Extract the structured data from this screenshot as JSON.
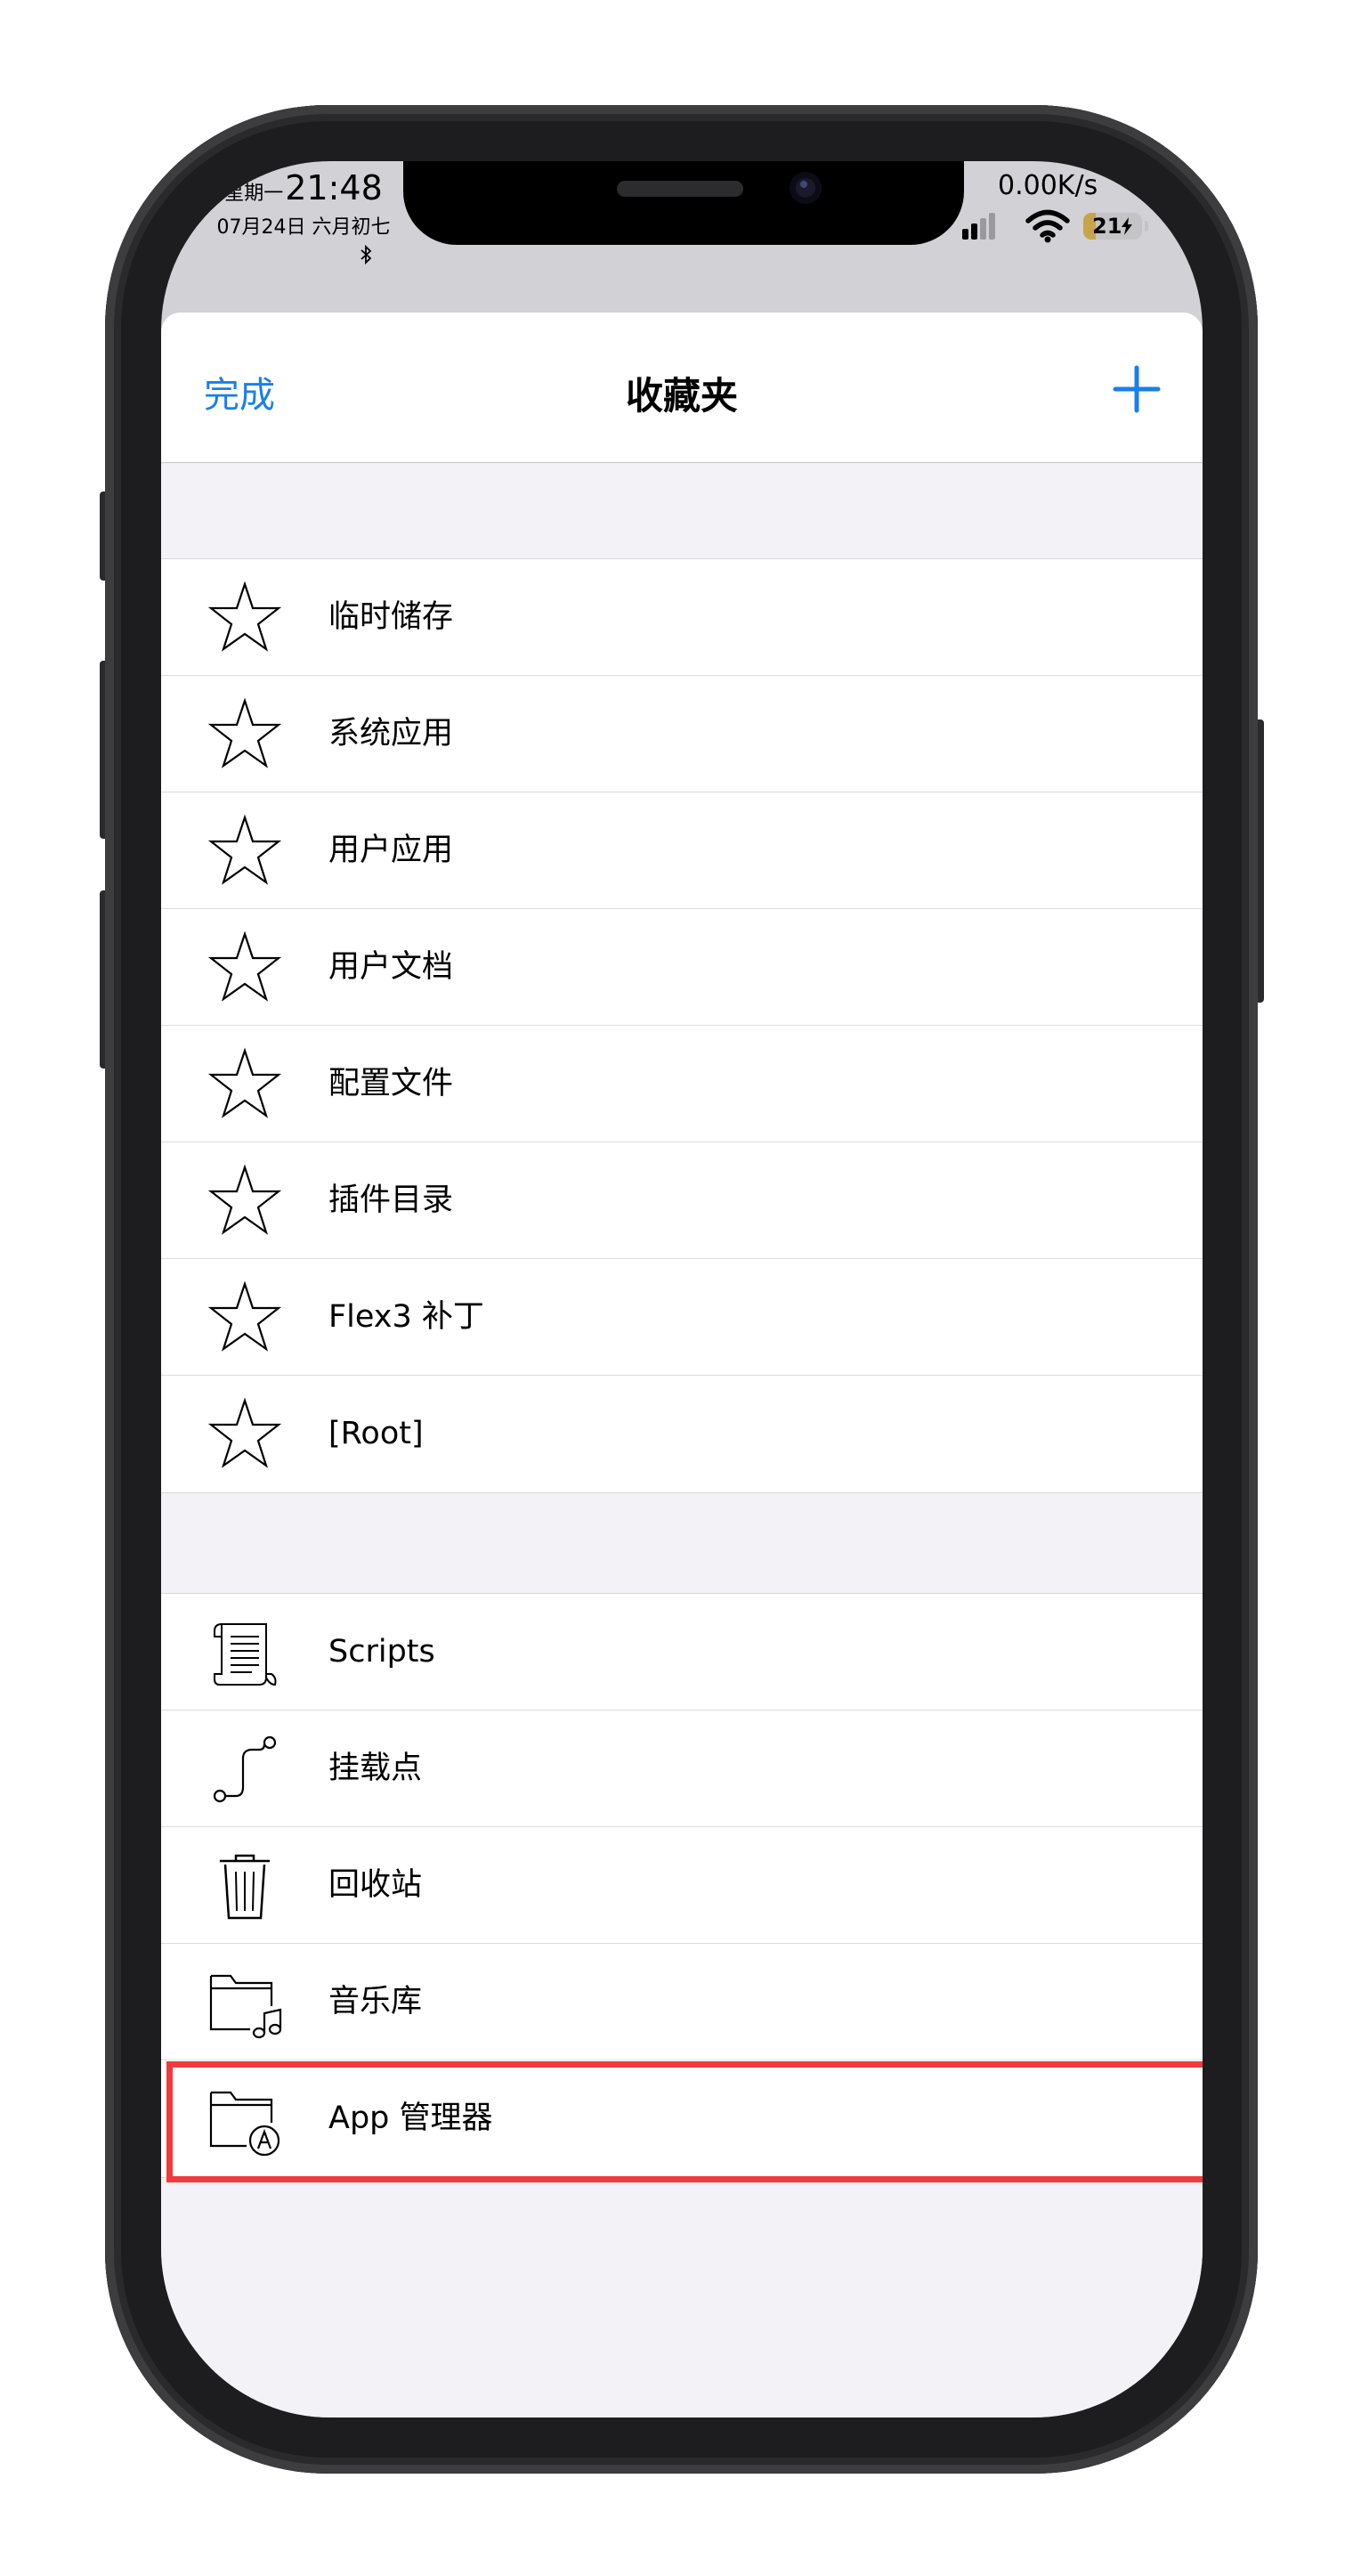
{
  "status_bar": {
    "weekday": "星期一",
    "time": "21:48",
    "date_line": "07月24日 六月初七",
    "bluetooth_icon": "bluetooth-icon",
    "net_speed": "0.00K/s",
    "battery_level": "21"
  },
  "nav": {
    "done_label": "完成",
    "title": "收藏夹",
    "add_icon": "plus-icon"
  },
  "favorites": [
    {
      "label": "临时储存",
      "icon": "star-icon"
    },
    {
      "label": "系统应用",
      "icon": "star-icon"
    },
    {
      "label": "用户应用",
      "icon": "star-icon"
    },
    {
      "label": "用户文档",
      "icon": "star-icon"
    },
    {
      "label": "配置文件",
      "icon": "star-icon"
    },
    {
      "label": "插件目录",
      "icon": "star-icon"
    },
    {
      "label": "Flex3 补丁",
      "icon": "star-icon"
    },
    {
      "label": "[Root]",
      "icon": "star-icon"
    }
  ],
  "locations": [
    {
      "label": "Scripts",
      "icon": "scroll-icon"
    },
    {
      "label": "挂载点",
      "icon": "mount-path-icon"
    },
    {
      "label": "回收站",
      "icon": "trash-icon"
    },
    {
      "label": "音乐库",
      "icon": "music-folder-icon"
    },
    {
      "label": "App 管理器",
      "icon": "app-folder-icon"
    }
  ],
  "colors": {
    "accent": "#1a7fe8",
    "highlight": "#ef3b3f",
    "group_background": "#f2f2f7"
  }
}
